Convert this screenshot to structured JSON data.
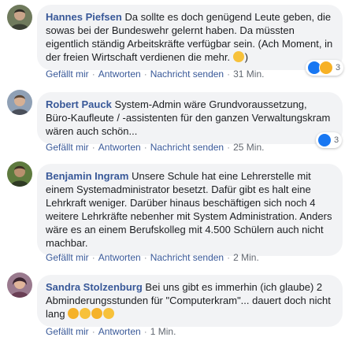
{
  "comments": [
    {
      "author": "Hannes Piefsen",
      "text": "Da sollte es doch genügend Leute geben, die sowas bei der Bundeswehr gelernt haben. Da müssten eigentlich ständig Arbeitskräfte verfügbar sein. (Ach Moment, in der freien Wirtschaft verdienen die mehr.",
      "text_end": ")",
      "inline_emojis": [
        "sweat-smile-emoji"
      ],
      "actions": {
        "like": "Gefällt mir",
        "reply": "Antworten",
        "message": "Nachricht senden",
        "time": "31 Min."
      },
      "reaction_icons": [
        "like-icon",
        "laugh-icon"
      ],
      "reaction_count": "3"
    },
    {
      "author": "Robert Pauck",
      "text": "System-Admin wäre Grundvoraussetzung, Büro-Kaufleute / -assistenten für den ganzen Verwaltungskram wären auch schön...",
      "actions": {
        "like": "Gefällt mir",
        "reply": "Antworten",
        "message": "Nachricht senden",
        "time": "25 Min."
      },
      "reaction_icons": [
        "like-icon"
      ],
      "reaction_count": "3"
    },
    {
      "author": "Benjamin Ingram",
      "text": "Unsere Schule hat eine Lehrerstelle mit einem Systemadministrator besetzt. Dafür gibt es halt eine Lehrkraft weniger. Darüber hinaus beschäftigen sich noch 4 weitere Lehrkräfte nebenher mit System Administration. Anders wäre es an einem Berufskolleg mit 4.500 Schülern auch nicht machbar.",
      "actions": {
        "like": "Gefällt mir",
        "reply": "Antworten",
        "message": "Nachricht senden",
        "time": "2 Min."
      }
    },
    {
      "author": "Sandra Stolzenburg",
      "text": "Bei uns gibt es immerhin (ich glaube) 2 Abminderungsstunden für \"Computerkram\"... dauert doch nicht lang",
      "inline_emojis": [
        "laugh-crying-emoji",
        "sad-emoji",
        "laugh-crying-emoji",
        "sad-emoji"
      ],
      "actions": {
        "like": "Gefällt mir",
        "reply": "Antworten",
        "time": "1 Min."
      }
    }
  ],
  "colors": {
    "author": "#385898",
    "bubble": "#f2f3f5",
    "meta": "#616770",
    "like_blue": "#1877f2"
  }
}
